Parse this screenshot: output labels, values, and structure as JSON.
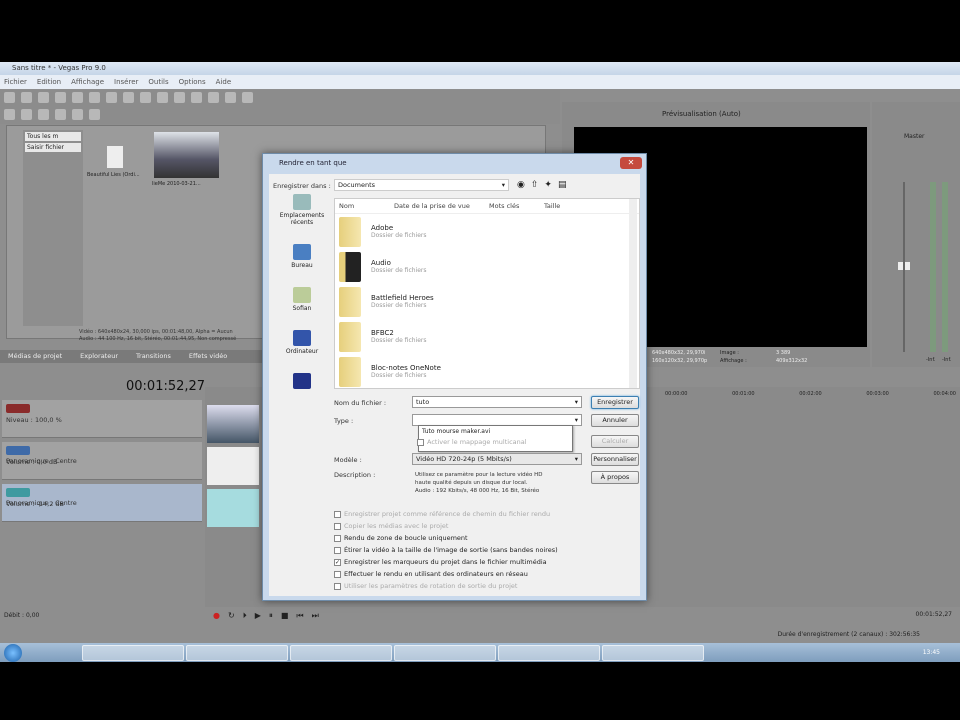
{
  "app": {
    "title": "Sans titre * - Vegas Pro 9.0",
    "menu": [
      "Fichier",
      "Edition",
      "Affichage",
      "Insérer",
      "Outils",
      "Options",
      "Aide"
    ],
    "explorer": {
      "tree": [
        "Tous les m",
        "Saisir fichier"
      ],
      "media": [
        "Beautiful Lies (Ordi...",
        "lieMe 2010-03-21..."
      ],
      "properties": [
        "Vidéo : 640x480x24, 30,000 ips, 00:01:48,00, Alpha = Aucun",
        "Audio : 44 100 Hz, 16 bit, Stéréo, 00:01:44,95, Non compressé"
      ]
    },
    "tabs": [
      "Médias de projet",
      "Explorateur",
      "Transitions",
      "Effets vidéo"
    ],
    "timecode": "00:01:52,27",
    "tracks": [
      {
        "label": "Niveau :",
        "value": "100,0 %"
      },
      {
        "label": "Volume :",
        "value": "0,0 dB",
        "pan": "Panoramique : Centre"
      },
      {
        "label": "Volume :",
        "value": "-14,2 dB",
        "pan": "Panoramique : Centre"
      }
    ],
    "preview": {
      "mode": "Prévisualisation (Auto)",
      "project": "640x480x32, 29,970i",
      "preview_res": "160x120x32, 29,970p",
      "image_label": "Image :",
      "image": "3 389",
      "display_label": "Affichage :",
      "display": "409x312x32"
    },
    "mixer": {
      "title": "Master",
      "left": "-Inf.",
      "right": "-Inf."
    },
    "ruler": [
      "00:00:00",
      "00:01:00",
      "00:02:00",
      "00:03:00",
      "00:04:00"
    ],
    "rate": "Débit : 0,00",
    "end_time": "00:01:52,27",
    "status": "Durée d'enregistrement (2 canaux) : 302:56:35"
  },
  "dialog": {
    "title": "Rendre en tant que",
    "save_in_label": "Enregistrer dans :",
    "save_in": "Documents",
    "close": "✕",
    "places": [
      "Emplacements récents",
      "Bureau",
      "Sofian",
      "Ordinateur"
    ],
    "columns": [
      "Nom",
      "Date de la prise de vue",
      "Mots clés",
      "Taille"
    ],
    "files": [
      {
        "name": "Adobe",
        "type": "Dossier de fichiers"
      },
      {
        "name": "Audio",
        "type": "Dossier de fichiers"
      },
      {
        "name": "Battlefield Heroes",
        "type": "Dossier de fichiers"
      },
      {
        "name": "BFBC2",
        "type": "Dossier de fichiers"
      },
      {
        "name": "Bloc-notes OneNote",
        "type": "Dossier de fichiers"
      }
    ],
    "filename_label": "Nom du fichier :",
    "filename": "tuto",
    "autocomplete": "Tuto mourse maker.avi",
    "type_label": "Type :",
    "multicanal": "Activer le mappage multicanal",
    "template_label": "Modèle :",
    "template": "Vidéo HD 720-24p (5 Mbits/s)",
    "description_label": "Description :",
    "description": [
      "Utilisez ce paramètre pour la lecture vidéo HD",
      "haute qualité depuis un disque dur local.",
      "Audio : 192 Kbits/s, 48 000 Hz, 16 Bit, Stéréo"
    ],
    "buttons": {
      "save": "Enregistrer",
      "cancel": "Annuler",
      "render": "Calculer",
      "custom": "Personnaliser",
      "about": "À propos"
    },
    "options": [
      {
        "label": "Enregistrer projet comme référence de chemin du fichier rendu",
        "checked": false,
        "enabled": false
      },
      {
        "label": "Copier les médias avec le projet",
        "checked": false,
        "enabled": false
      },
      {
        "label": "Rendu de zone de boucle uniquement",
        "checked": false,
        "enabled": true
      },
      {
        "label": "Étirer la vidéo à la taille de l'image de sortie (sans bandes noires)",
        "checked": false,
        "enabled": true
      },
      {
        "label": "Enregistrer les marqueurs du projet dans le fichier multimédia",
        "checked": true,
        "enabled": true
      },
      {
        "label": "Effectuer le rendu en utilisant des ordinateurs en réseau",
        "checked": false,
        "enabled": true
      },
      {
        "label": "Utiliser les paramètres de rotation de sortie du projet",
        "checked": false,
        "enabled": false
      }
    ]
  },
  "taskbar": {
    "time": "13:45"
  }
}
